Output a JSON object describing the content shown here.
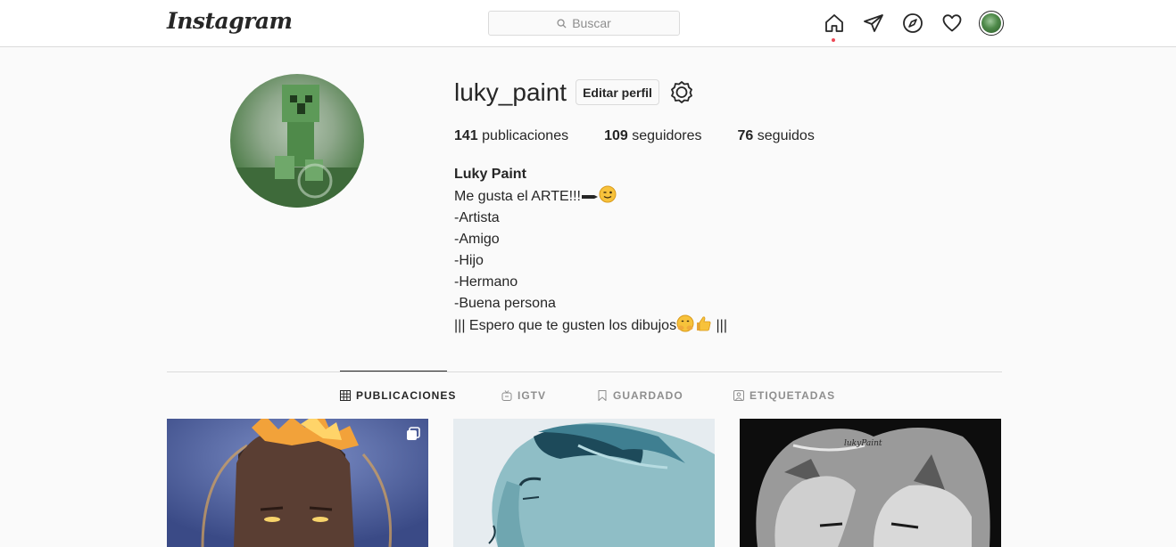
{
  "header": {
    "logo": "Instagram",
    "search_placeholder": "Buscar",
    "icons": [
      "home-icon",
      "direct-icon",
      "explore-icon",
      "activity-icon",
      "profile-avatar"
    ]
  },
  "profile": {
    "username": "luky_paint",
    "edit_button": "Editar perfil",
    "stats": {
      "posts_count": "141",
      "posts_label": " publicaciones",
      "followers_count": "109",
      "followers_label": " seguidores",
      "following_count": "76",
      "following_label": " seguidos"
    },
    "bio": {
      "full_name": "Luky Paint",
      "line1": "Me gusta el ARTE!!!",
      "line2": "-Artista",
      "line3": "-Amigo",
      "line4": "-Hijo",
      "line5": "-Hermano",
      "line6": "-Buena persona",
      "line7_start": "||| Espero que te gusten los dibujos",
      "line7_end": " |||"
    }
  },
  "tabs": [
    {
      "label": "PUBLICACIONES",
      "icon": "grid-icon",
      "active": true
    },
    {
      "label": "IGTV",
      "icon": "igtv-icon",
      "active": false
    },
    {
      "label": "GUARDADO",
      "icon": "bookmark-icon",
      "active": false
    },
    {
      "label": "ETIQUETADAS",
      "icon": "tagged-icon",
      "active": false
    }
  ],
  "colors": {
    "background": "#fafafa",
    "border": "#dbdbdb",
    "text": "#262626",
    "muted": "#8e8e8e",
    "notification": "#ed4956"
  }
}
